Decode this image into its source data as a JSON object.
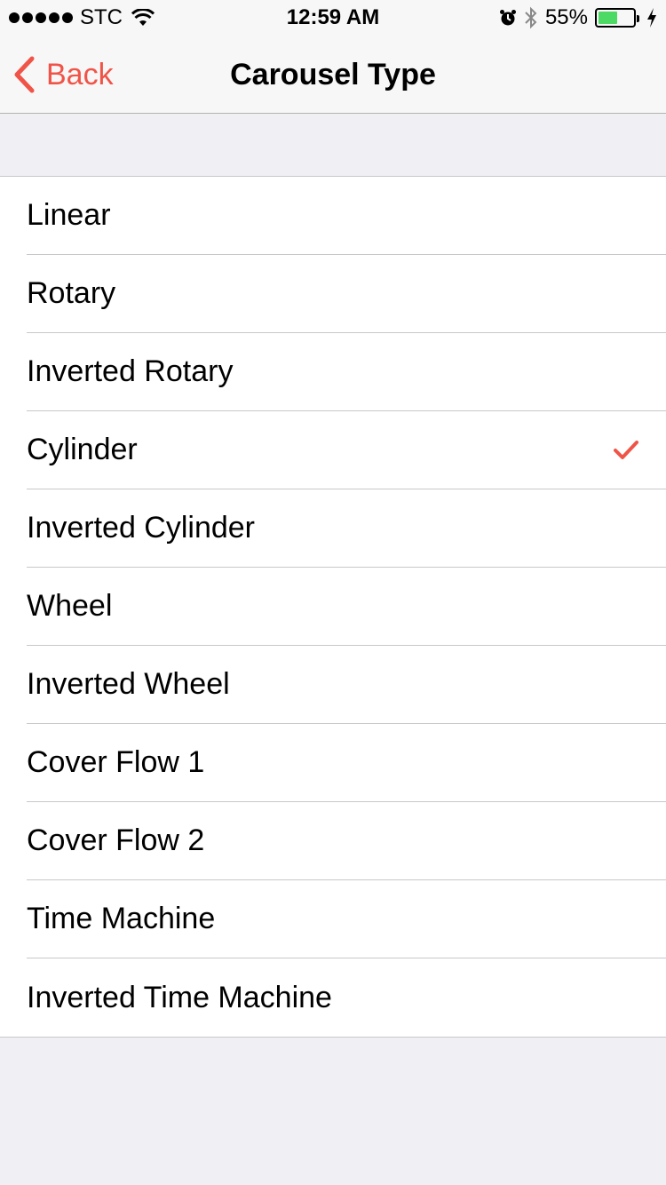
{
  "status_bar": {
    "carrier": "STC",
    "time": "12:59 AM",
    "battery_percent": "55%",
    "battery_level": 0.55,
    "signal_bars": 5
  },
  "nav": {
    "back_label": "Back",
    "title": "Carousel Type"
  },
  "accent_color": "#f05448",
  "list": {
    "items": [
      {
        "label": "Linear",
        "selected": false
      },
      {
        "label": "Rotary",
        "selected": false
      },
      {
        "label": "Inverted Rotary",
        "selected": false
      },
      {
        "label": "Cylinder",
        "selected": true
      },
      {
        "label": "Inverted Cylinder",
        "selected": false
      },
      {
        "label": "Wheel",
        "selected": false
      },
      {
        "label": "Inverted Wheel",
        "selected": false
      },
      {
        "label": "Cover Flow 1",
        "selected": false
      },
      {
        "label": "Cover Flow 2",
        "selected": false
      },
      {
        "label": "Time Machine",
        "selected": false
      },
      {
        "label": "Inverted Time Machine",
        "selected": false
      }
    ]
  },
  "icons": {
    "back": "chevron-left-icon",
    "check": "checkmark-icon",
    "wifi": "wifi-icon",
    "alarm": "alarm-clock-icon",
    "bluetooth": "bluetooth-icon",
    "charging": "bolt-icon"
  }
}
